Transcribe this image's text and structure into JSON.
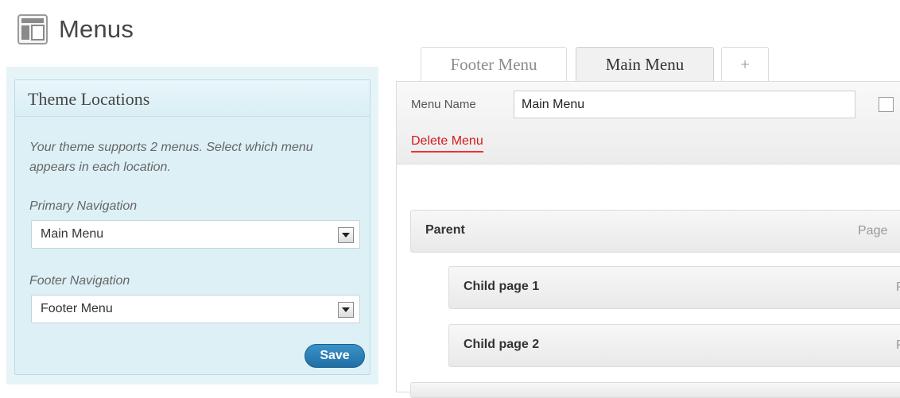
{
  "page": {
    "title": "Menus",
    "icon": "menus-icon"
  },
  "theme_locations": {
    "heading": "Theme Locations",
    "description": "Your theme supports 2 menus. Select which menu appears in each location.",
    "primary_label": "Primary Navigation",
    "primary_value": "Main Menu",
    "footer_label": "Footer Navigation",
    "footer_value": "Footer Menu",
    "save_label": "Save"
  },
  "tabs": [
    {
      "label": "Footer Menu",
      "active": false
    },
    {
      "label": "Main Menu",
      "active": true
    },
    {
      "label": "+",
      "active": false
    }
  ],
  "menu_editor": {
    "name_label": "Menu Name",
    "name_value": "Main Menu",
    "delete_label": "Delete Menu",
    "items": [
      {
        "title": "Parent",
        "type": "Page",
        "depth": 0
      },
      {
        "title": "Child page 1",
        "type": "Page",
        "depth": 1
      },
      {
        "title": "Child page 2",
        "type": "Page",
        "depth": 1
      }
    ]
  },
  "colors": {
    "save_button": "#2a7fb8",
    "delete_link": "#d21a1a",
    "theme_panel_bg": "#ddf0f6"
  }
}
